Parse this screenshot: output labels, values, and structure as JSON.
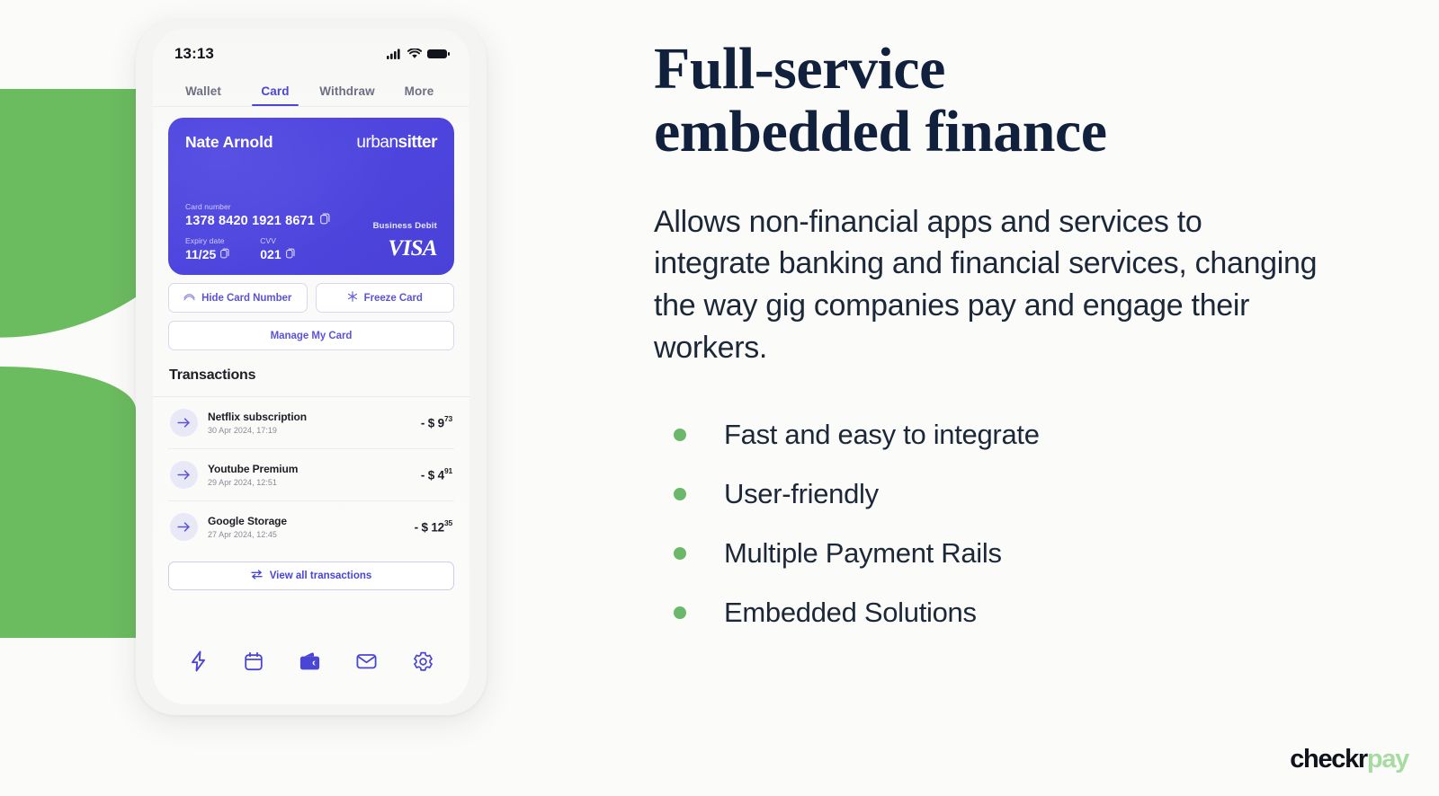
{
  "theme": {
    "background": "#fbfbf9",
    "brand_purple": "#4b45d6",
    "brand_green": "#6bbb5f",
    "headline_navy": "#11203c",
    "logo_green": "#a7dba2"
  },
  "phone": {
    "status_bar": {
      "time": "13:13",
      "icons": [
        "cellular-signal-icon",
        "wifi-icon",
        "battery-icon"
      ]
    },
    "tabs": [
      {
        "label": "Wallet",
        "active": false
      },
      {
        "label": "Card",
        "active": true
      },
      {
        "label": "Withdraw",
        "active": false
      },
      {
        "label": "More",
        "active": false
      }
    ],
    "card": {
      "holder_name": "Nate Arnold",
      "brand_prefix": "urban",
      "brand_suffix": "sitter",
      "card_number_label": "Card number",
      "card_number": "1378 8420 1921 8671",
      "expiry_label": "Expiry date",
      "expiry_value": "11/25",
      "cvv_label": "CVV",
      "cvv_value": "021",
      "card_type": "Business Debit",
      "network": "VISA"
    },
    "actions": {
      "hide_card_number": "Hide Card Number",
      "freeze_card": "Freeze Card",
      "manage_my_card": "Manage My Card"
    },
    "transactions_title": "Transactions",
    "transactions": [
      {
        "name": "Netflix subscription",
        "date": "30 Apr 2024, 17:19",
        "amount_main": "- $ 9",
        "amount_cents": "73"
      },
      {
        "name": "Youtube Premium",
        "date": "29 Apr 2024, 12:51",
        "amount_main": "- $ 4",
        "amount_cents": "91"
      },
      {
        "name": "Google Storage",
        "date": "27 Apr 2024, 12:45",
        "amount_main": "- $ 12",
        "amount_cents": "35"
      }
    ],
    "view_all_label": "View all transactions",
    "bottom_nav": [
      {
        "icon": "lightning-icon",
        "active": false
      },
      {
        "icon": "calendar-icon",
        "active": false
      },
      {
        "icon": "wallet-icon",
        "active": true
      },
      {
        "icon": "mail-icon",
        "active": false
      },
      {
        "icon": "gear-icon",
        "active": false
      }
    ]
  },
  "content": {
    "headline_line1": "Full-service",
    "headline_line2": "embedded finance",
    "body": "Allows non-financial apps and services to integrate banking and financial services, changing the way gig companies pay and engage their workers.",
    "bullets": [
      "Fast and easy to integrate",
      "User-friendly",
      "Multiple Payment Rails",
      "Embedded Solutions"
    ]
  },
  "logo": {
    "dark_part": "checkr",
    "green_part": "pay"
  }
}
